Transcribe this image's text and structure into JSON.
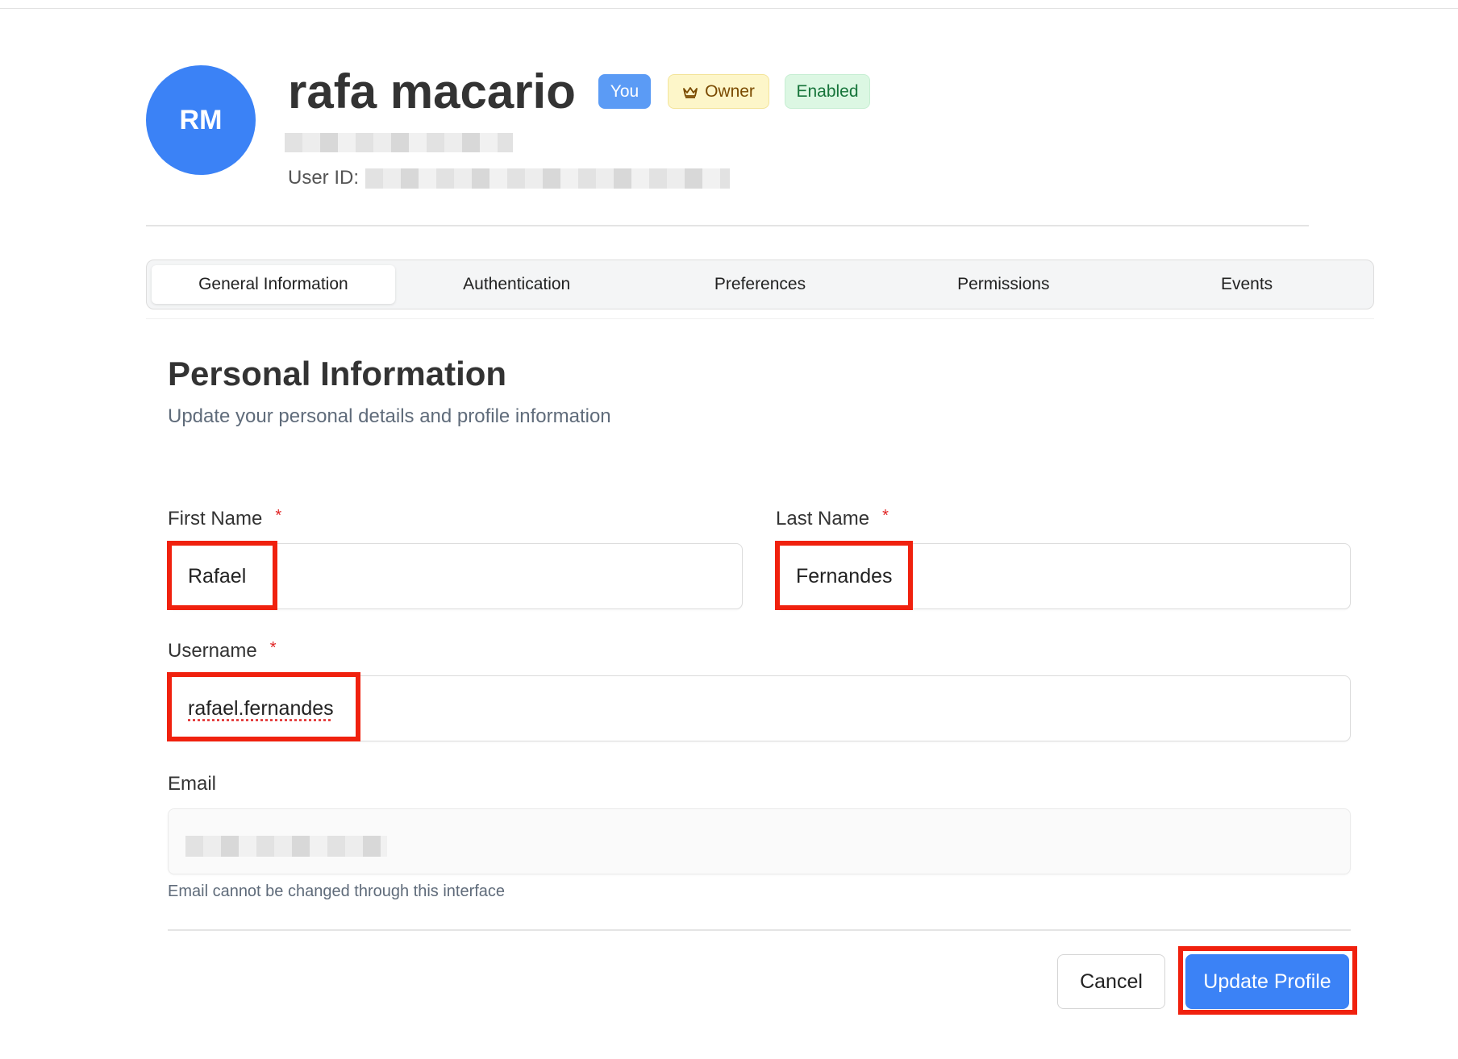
{
  "header": {
    "avatar_initials": "RM",
    "user_name": "rafa macario",
    "badges": {
      "you": "You",
      "owner": "Owner",
      "enabled": "Enabled"
    },
    "user_id_label": "User ID:"
  },
  "tabs": [
    {
      "label": "General Information",
      "active": true
    },
    {
      "label": "Authentication",
      "active": false
    },
    {
      "label": "Preferences",
      "active": false
    },
    {
      "label": "Permissions",
      "active": false
    },
    {
      "label": "Events",
      "active": false
    }
  ],
  "section": {
    "title": "Personal Information",
    "subtitle": "Update your personal details and profile information"
  },
  "form": {
    "first_name": {
      "label": "First Name",
      "required_mark": "*",
      "value": "Rafael"
    },
    "last_name": {
      "label": "Last Name",
      "required_mark": "*",
      "value": "Fernandes"
    },
    "username": {
      "label": "Username",
      "required_mark": "*",
      "value": "rafael.fernandes"
    },
    "email": {
      "label": "Email",
      "helper": "Email cannot be changed through this interface"
    }
  },
  "actions": {
    "cancel_label": "Cancel",
    "update_label": "Update Profile"
  },
  "colors": {
    "primary": "#3b82f6",
    "highlight": "#f0210e",
    "required": "#e02424"
  }
}
